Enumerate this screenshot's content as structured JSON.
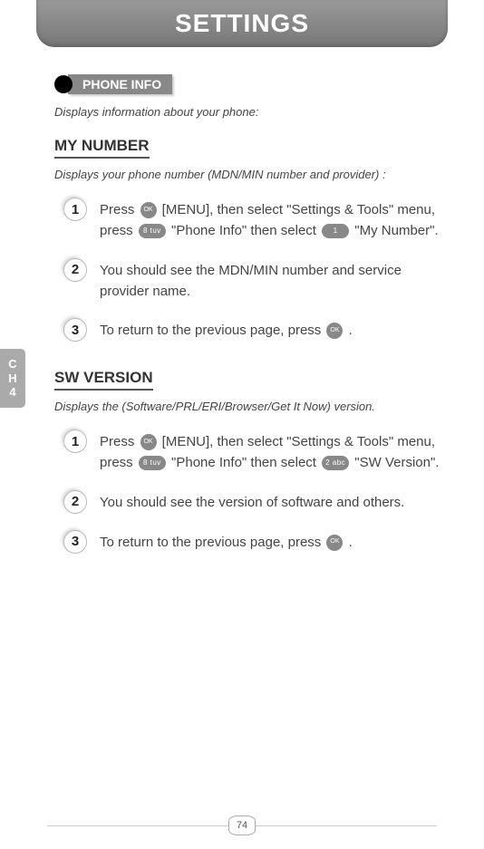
{
  "header": {
    "title": "SETTINGS"
  },
  "side_tab": {
    "line1": "C",
    "line2": "H",
    "line3": "4"
  },
  "section": {
    "label": "PHONE INFO",
    "intro": "Displays information about your phone:"
  },
  "sub1": {
    "title": "MY NUMBER",
    "desc": "Displays your phone number (MDN/MIN number and provider) :",
    "step1_a": "Press ",
    "step1_b": " [MENU], then select \"Settings & Tools\" menu, press ",
    "step1_c": " \"Phone Info\" then select ",
    "step1_d": " \"My Number\".",
    "step2": "You should see the MDN/MIN number and service provider name.",
    "step3_a": "To return to the previous page, press ",
    "step3_b": " ."
  },
  "sub2": {
    "title": "SW VERSION",
    "desc": "Displays the (Software/PRL/ERI/Browser/Get It Now) version.",
    "step1_a": "Press ",
    "step1_b": " [MENU], then select \"Settings & Tools\" menu, press ",
    "step1_c": " \"Phone Info\" then select ",
    "step1_d": " \"SW Version\".",
    "step2": "You should see the version of software and others.",
    "step3_a": "To return to the previous page, press ",
    "step3_b": " ."
  },
  "keys": {
    "ok": "OK",
    "k8": "8 tuv",
    "k1": "1",
    "k2": "2 abc"
  },
  "nums": {
    "n1": "1",
    "n2": "2",
    "n3": "3"
  },
  "page": {
    "number": "74"
  }
}
